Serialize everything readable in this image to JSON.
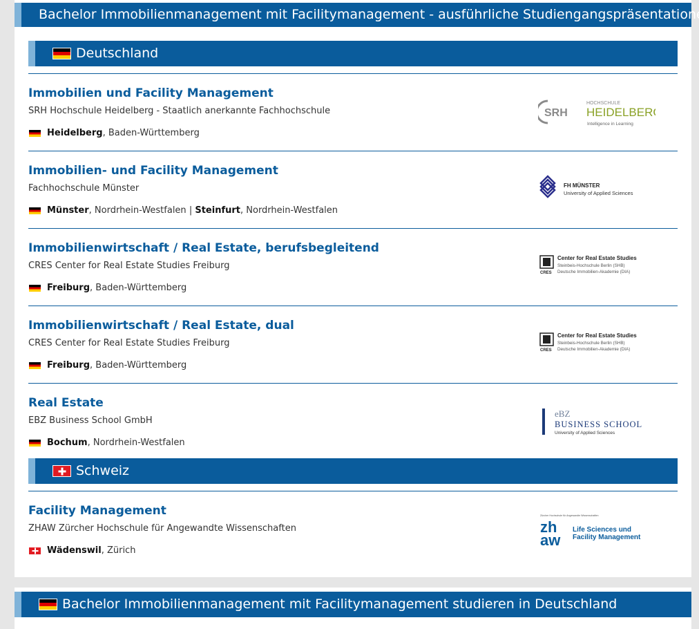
{
  "page_title": "Bachelor Immobilienmanagement mit Facilitymanagement - ausführliche Studiengangspräsentationen",
  "sections": [
    {
      "country": "Deutschland",
      "flag": "de",
      "entries": [
        {
          "title": "Immobilien und Facility Management",
          "school": "SRH Hochschule Heidelberg - Staatlich anerkannte Fachhochschule",
          "locations": [
            {
              "city": "Heidelberg",
              "region": ", Baden-Württemberg"
            }
          ],
          "logo": {
            "name": "srh-heidelberg-logo",
            "mark": "SRH",
            "top": "HOCHSCHULE",
            "main": "HEIDELBERG",
            "sub": "Intelligence in Learning"
          }
        },
        {
          "title": "Immobilien- und Facility Management",
          "school": "Fachhochschule Münster",
          "locations": [
            {
              "city": "Münster",
              "region": ", Nordrhein-Westfalen"
            },
            {
              "city": "Steinfurt",
              "region": ", Nordrhein-Westfalen"
            }
          ],
          "logo": {
            "name": "fh-muenster-logo",
            "main": "FH MÜNSTER",
            "sub": "University of Applied Sciences"
          }
        },
        {
          "title": "Immobilienwirtschaft / Real Estate, berufsbegleitend",
          "school": "CRES Center for Real Estate Studies Freiburg",
          "locations": [
            {
              "city": "Freiburg",
              "region": ", Baden-Württemberg"
            }
          ],
          "logo": {
            "name": "cres-logo",
            "mark": "CRES",
            "main": "Center for Real Estate Studies",
            "sub": "Steinbeis-Hochschule Berlin (SHB)",
            "sub2": "Deutsche Immobilien-Akademie (DIA)"
          }
        },
        {
          "title": "Immobilienwirtschaft / Real Estate, dual",
          "school": "CRES Center for Real Estate Studies Freiburg",
          "locations": [
            {
              "city": "Freiburg",
              "region": ", Baden-Württemberg"
            }
          ],
          "logo": {
            "name": "cres-logo",
            "mark": "CRES",
            "main": "Center for Real Estate Studies",
            "sub": "Steinbeis-Hochschule Berlin (SHB)",
            "sub2": "Deutsche Immobilien-Akademie (DIA)"
          }
        },
        {
          "title": "Real Estate",
          "school": "EBZ Business School GmbH",
          "locations": [
            {
              "city": "Bochum",
              "region": ", Nordrhein-Westfalen"
            }
          ],
          "logo": {
            "name": "ebz-logo",
            "top": "eBZ",
            "main": "BUSINESS SCHOOL",
            "sub": "University of Applied Sciences"
          }
        }
      ]
    },
    {
      "country": "Schweiz",
      "flag": "ch",
      "entries": [
        {
          "title": "Facility Management",
          "school": "ZHAW Zürcher Hochschule für Angewandte Wissenschaften",
          "locations": [
            {
              "city": "Wädenswil",
              "region": ", Zürich"
            }
          ],
          "logo": {
            "name": "zhaw-logo",
            "mark": "zh",
            "mark2": "aw",
            "top": "Zürcher Hochschule für Angewandte Wissenschaften",
            "main": "Life Sciences und",
            "sub": "Facility Management"
          }
        }
      ]
    }
  ],
  "bottom_header": {
    "flag": "de",
    "title": "Bachelor Immobilienmanagement mit Facilitymanagement studieren in Deutschland"
  },
  "location_separator": " | ",
  "colors": {
    "primary": "#0a5c9c",
    "accent_bar": "#7fb3d9",
    "background": "#e6e6e6",
    "srh_green": "#8aa126",
    "srh_gray": "#8a8a8a",
    "fh_blue": "#2a2e8c",
    "ebz_blue": "#1c3a78"
  }
}
